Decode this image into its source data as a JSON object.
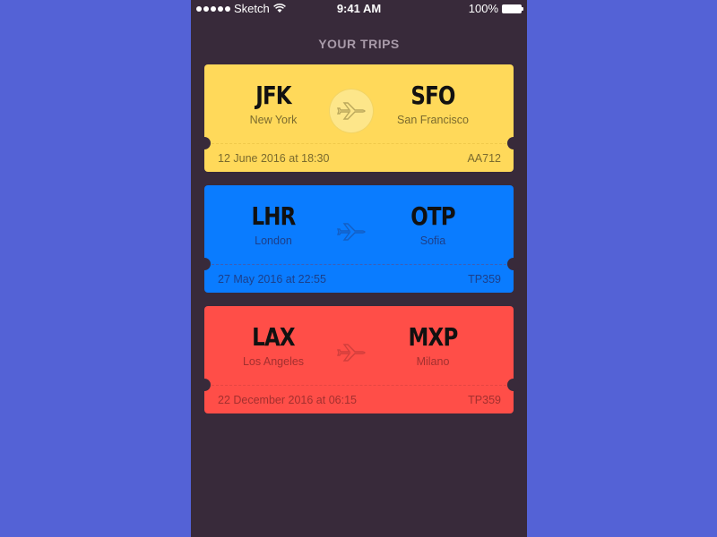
{
  "status_bar": {
    "carrier": "Sketch",
    "time": "9:41 AM",
    "battery": "100%"
  },
  "header": {
    "title": "YOUR TRIPS"
  },
  "trips": [
    {
      "from_code": "JFK",
      "from_city": "New York",
      "to_code": "SFO",
      "to_city": "San Francisco",
      "date": "12 June 2016 at 18:30",
      "flight": "AA712",
      "color": "#ffd95a",
      "text_color": "#7a6a2e",
      "divider_color": "#f0c94a",
      "icon": "airplane-icon"
    },
    {
      "from_code": "LHR",
      "from_city": "London",
      "to_code": "OTP",
      "to_city": "Sofia",
      "date": "27 May 2016 at 22:55",
      "flight": "TP359",
      "color": "#0a7cff",
      "text_color": "#1d3f8a",
      "divider_color": "#3d5fb8",
      "icon": "airplane-icon"
    },
    {
      "from_code": "LAX",
      "from_city": "Los Angeles",
      "to_code": "MXP",
      "to_city": "Milano",
      "date": "22 December 2016 at 06:15",
      "flight": "TP359",
      "color": "#ff4e48",
      "text_color": "#a3302f",
      "divider_color": "#e54541",
      "icon": "airplane-icon"
    }
  ]
}
